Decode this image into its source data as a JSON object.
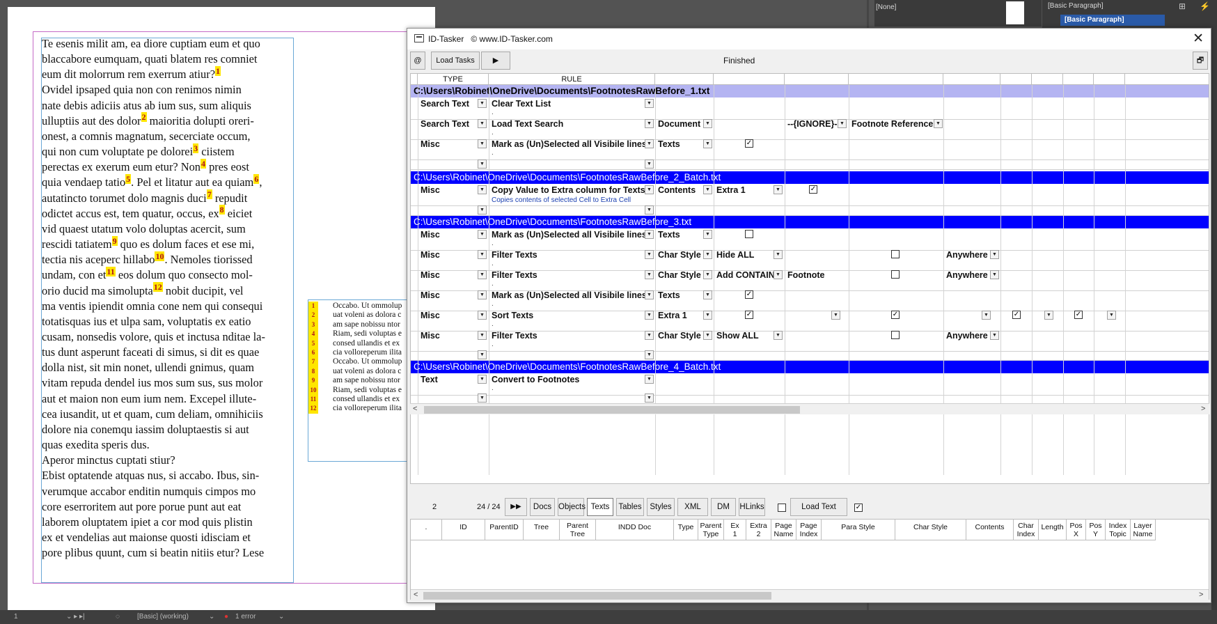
{
  "indesign": {
    "body_lines": [
      {
        "t": "Te esenis milit am, ea diore cuptiam eum et quo",
        "fn": ""
      },
      {
        "t": "blaccabore eumquam, quati blatem res comniet",
        "fn": ""
      },
      {
        "t": "eum dit molorrum rem exerrum atiur?",
        "fn": "1"
      },
      {
        "t": "Ovidel ipsaped quia non con renimos nimin",
        "fn": ""
      },
      {
        "t": "nate debis adiciis atus ab ium sus, sum aliquis",
        "fn": ""
      },
      {
        "t": "ulluptiis aut des dolor",
        "fn": "2",
        "after": " maioritia dolupti oreri-"
      },
      {
        "t": "onest, a comnis magnatum, secerciate occum,",
        "fn": ""
      },
      {
        "t": "qui non cum voluptate pe dolorei",
        "fn": "3",
        "after": " ciistem"
      },
      {
        "t": "perectas ex exerum eum etur? Non",
        "fn": "4",
        "after": " pres eost"
      },
      {
        "t": "quia vendaep tatio",
        "fn": "5",
        "after": ". Pel et litatur aut ea quiam",
        "fn2": "6",
        "after2": ","
      },
      {
        "t": "autatincto torumet dolo magnis duci",
        "fn": "7",
        "after": " repudit"
      },
      {
        "t": "odictet accus est, tem quatur, occus, ex",
        "fn": "8",
        "after": " eiciet"
      },
      {
        "t": "vid quaest utatum volo doluptas acercit, sum",
        "fn": ""
      },
      {
        "t": "rescidi tatiatem",
        "fn": "9",
        "after": " quo es dolum faces et ese mi,"
      },
      {
        "t": "tectia nis aceperc hillabo",
        "fn": "10",
        "after": ". Nemoles tiorissed"
      },
      {
        "t": "undam, con et",
        "fn": "11",
        "after": " eos dolum quo consecto mol-"
      },
      {
        "t": "orio ducid ma simolupta",
        "fn": "12",
        "after": " nobit ducipit, vel"
      },
      {
        "t": "ma ventis ipiendit omnia cone nem qui consequi",
        "fn": ""
      },
      {
        "t": "totatisquas ius et ulpa sam, voluptatis ex eatio",
        "fn": ""
      },
      {
        "t": "cusam, nonsedis volore, quis et inctusa nditae la-",
        "fn": ""
      },
      {
        "t": "tus dunt asperunt faceati di simus, si dit es quae",
        "fn": ""
      },
      {
        "t": "dolla nist, sit min nonet, ullendi gnimus, quam",
        "fn": ""
      },
      {
        "t": "vitam repuda dendel ius mos sum sus, sus molor",
        "fn": ""
      },
      {
        "t": "aut et maion non eum ium nem. Excepel illute-",
        "fn": ""
      },
      {
        "t": "cea iusandit, ut et quam, cum deliam, omnihiciis",
        "fn": ""
      },
      {
        "t": "dolore nia conemqu iassim doluptaestis si aut",
        "fn": ""
      },
      {
        "t": "quas exedita speris dus.",
        "fn": ""
      },
      {
        "t": "Aperor minctus cuptati stiur?",
        "fn": ""
      },
      {
        "t": "Ebist optatende atquas nus, si accabo. Ibus, sin-",
        "fn": ""
      },
      {
        "t": "verumque accabor enditin numquis cimpos mo",
        "fn": ""
      },
      {
        "t": "core eserroritem aut pore porue punt aut eat",
        "fn": ""
      },
      {
        "t": "laborem oluptatem ipiet a cor mod quis plistin",
        "fn": ""
      },
      {
        "t": "ex et vendelias aut maionse quosti idisciam et",
        "fn": ""
      },
      {
        "t": "pore plibus quunt, cum si beatin nitiis etur? Lese",
        "fn": ""
      }
    ],
    "footnote_numbers": [
      "1",
      "2",
      "3",
      "4",
      "5",
      "6",
      "7",
      "8",
      "9",
      "10",
      "11",
      "12"
    ],
    "footnote_lines": [
      "Occabo. Ut ommolup",
      "uat voleni as dolora c",
      "am sape nobissu ntor",
      "Riam, sedi voluptas e",
      " consed ullandis et ex",
      "cia volloreperum ilita",
      "Occabo. Ut ommolup",
      "uat voleni as dolora c",
      "am sape nobissu ntor",
      "Riam, sedi voluptas e",
      " consed ullandis et ex",
      "cia volloreperum ilita"
    ],
    "panel_none": "[None]",
    "para_style_1": "[Basic Paragraph]",
    "para_style_2": "[Basic Paragraph]",
    "status_page": "1",
    "status_profile": "[Basic] (working)",
    "status_errors": "1 error"
  },
  "window": {
    "title": "ID-Tasker",
    "copyright": "© www.ID-Tasker.com",
    "close": "✕"
  },
  "toolbar": {
    "at_label": "@",
    "load_tasks": "Load Tasks",
    "run_icon": "▶",
    "status": "Finished",
    "restore_icon": "🗗"
  },
  "grid": {
    "col_type": "TYPE",
    "col_rule": "RULE",
    "files": [
      "C:\\Users\\Robinet\\OneDrive\\Documents\\FootnotesRawBefore_1.txt",
      "C:\\Users\\Robinet\\OneDrive\\Documents\\FootnotesRawBefore_2_Batch.txt",
      "C:\\Users\\Robinet\\OneDrive\\Documents\\FootnotesRawBefore_3.txt",
      "C:\\Users\\Robinet\\OneDrive\\Documents\\FootnotesRawBefore_4_Batch.txt"
    ],
    "rows": [
      {
        "type": "Search Text",
        "rule": "Clear Text List"
      },
      {
        "type": "Search Text",
        "rule": "Load Text Search",
        "c3": "Document",
        "c5": "--{IGNORE}--",
        "c6": "Footnote Reference"
      },
      {
        "type": "Misc",
        "rule": "Mark as (Un)Selected all Visibile lines",
        "c3": "Texts",
        "chk4": "✓"
      },
      {
        "type": "Misc",
        "rule": "Copy Value to Extra column for Texts",
        "c3": "Contents",
        "c4": "Extra 1",
        "chk5": "✓",
        "note": "Copies contents of selected Cell to Extra Cell"
      },
      {
        "type": "Misc",
        "rule": "Mark as (Un)Selected all Visibile lines",
        "c3": "Texts",
        "chk4": ""
      },
      {
        "type": "Misc",
        "rule": "Filter Texts",
        "c3": "Char Style",
        "c4": "Hide ALL",
        "chk6": "",
        "c7": "Anywhere"
      },
      {
        "type": "Misc",
        "rule": "Filter Texts",
        "c3": "Char Style",
        "c4": "Add CONTAIN",
        "c5": "Footnote",
        "chk6": "",
        "c7": "Anywhere"
      },
      {
        "type": "Misc",
        "rule": "Mark as (Un)Selected all Visibile lines",
        "c3": "Texts",
        "chk4": "✓"
      },
      {
        "type": "Misc",
        "rule": "Sort Texts",
        "c3": "Extra 1",
        "chk4": "✓",
        "chk6": "✓",
        "chk8": "✓",
        "chk10": "✓"
      },
      {
        "type": "Misc",
        "rule": "Filter Texts",
        "c3": "Char Style",
        "c4": "Show ALL",
        "chk6": "",
        "c7": "Anywhere"
      },
      {
        "type": "Text",
        "rule": "Convert to Footnotes"
      }
    ],
    "dot": "."
  },
  "bottom_toolbar": {
    "count": "2",
    "pager": "24 / 24",
    "next_icon": "▶▶",
    "tabs": [
      "Docs",
      "Objects",
      "Texts",
      "Tables",
      "Styles",
      "XML",
      "DM",
      "HLinks"
    ],
    "active_tab": "Texts",
    "load_text": "Load Text",
    "chk_left": "",
    "chk_right": "✓"
  },
  "bottom_table": {
    "columns": [
      ".",
      "ID",
      "ParentID",
      "Tree",
      "Parent\nTree",
      "INDD Doc",
      "Type",
      "Parent\nType",
      "Ex\n1",
      "Extra\n2",
      "Page\nName",
      "Page\nIndex",
      "Para Style",
      "Char Style",
      "Contents",
      "Char\nIndex",
      "Length",
      "Pos\nX",
      "Pos\nY",
      "Index\nTopic",
      "Layer\nName"
    ]
  }
}
